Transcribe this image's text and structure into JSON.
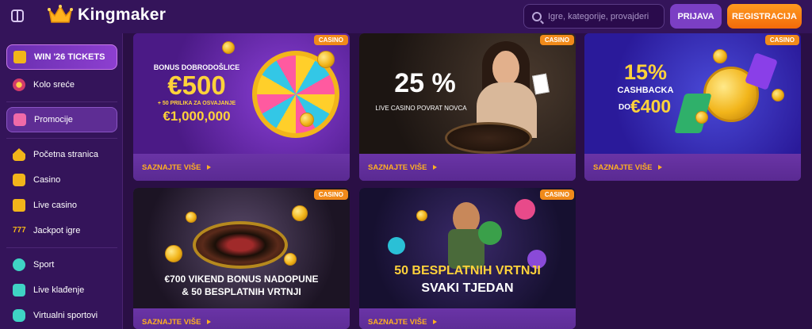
{
  "header": {
    "brand": "Kingmaker",
    "search_placeholder": "Igre, kategorije, provajderi",
    "login_label": "PRIJAVA",
    "register_label": "REGISTRACIJA"
  },
  "sidebar": {
    "items": [
      {
        "label": "WIN '26 TICKETS",
        "icon": "trophy-icon"
      },
      {
        "label": "Kolo sreće",
        "icon": "wheel-icon"
      },
      {
        "label": "Promocije",
        "icon": "gift-icon"
      },
      {
        "label": "Početna stranica",
        "icon": "home-icon"
      },
      {
        "label": "Casino",
        "icon": "slot-icon"
      },
      {
        "label": "Live casino",
        "icon": "live-casino-icon"
      },
      {
        "label": "Jackpot igre",
        "icon": "jackpot-icon"
      },
      {
        "label": "Sport",
        "icon": "ball-icon"
      },
      {
        "label": "Live klađenje",
        "icon": "live-bet-icon"
      },
      {
        "label": "Virtualni sportovi",
        "icon": "gamepad-icon"
      }
    ]
  },
  "cards": [
    {
      "badge": "CASINO",
      "cta": "SAZNAJTE VIŠE",
      "art": {
        "line1": "BONUS DOBRODOŠLICE",
        "line2": "€500",
        "line3": "+ 50 PRILIKA ZA OSVAJANJE",
        "line4": "€1,000,000"
      }
    },
    {
      "badge": "CASINO",
      "cta": "SAZNAJTE VIŠE",
      "art": {
        "line1": "25 %",
        "line2": "LIVE CASINO POVRAT NOVCA"
      }
    },
    {
      "badge": "CASINO",
      "cta": "SAZNAJTE VIŠE",
      "art": {
        "line1": "15%",
        "line2": "CASHBACKA",
        "line3": "DO",
        "line4": "€400"
      }
    },
    {
      "badge": "CASINO",
      "cta": "SAZNAJTE VIŠE",
      "art": {
        "line1": "€700 VIKEND BONUS NADOPUNE",
        "line2": "& 50 BESPLATNIH VRTNJI"
      }
    },
    {
      "badge": "CASINO",
      "cta": "SAZNAJTE VIŠE",
      "art": {
        "line1": "50 BESPLATNIH VRTNJI",
        "line2": "SVAKI TJEDAN"
      }
    }
  ],
  "colors": {
    "background": "#2a0f45",
    "sidebar": "#34145a",
    "accent_orange": "#f08a1a",
    "cta_gold": "#ffb021",
    "login_button": "#7b3fc4"
  }
}
